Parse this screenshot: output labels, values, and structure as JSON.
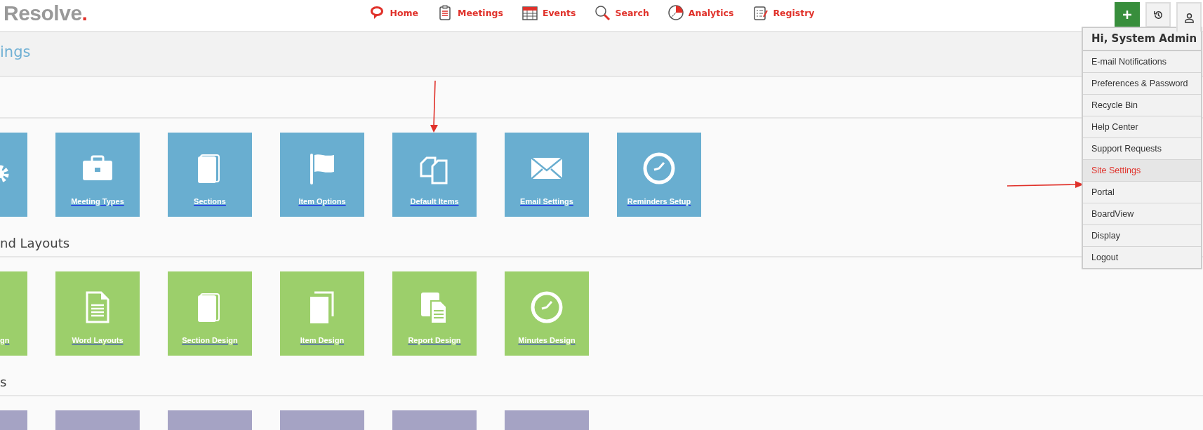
{
  "logo": {
    "text": "Resolve",
    "dot": "."
  },
  "nav": [
    {
      "label": "Home"
    },
    {
      "label": "Meetings"
    },
    {
      "label": "Events"
    },
    {
      "label": "Search"
    },
    {
      "label": "Analytics"
    },
    {
      "label": "Registry"
    }
  ],
  "page_title": "ings",
  "sections": [
    {
      "color": "#69aed0",
      "tiles": [
        {
          "cut_off": true
        },
        {
          "label": "Meeting Types",
          "cut_off": false
        },
        {
          "label": "Sections",
          "cut_off": false
        },
        {
          "label": "Item Options",
          "cut_off": false
        },
        {
          "label": "Default Items",
          "cut_off": false
        },
        {
          "label": "Email Settings",
          "cut_off": false
        },
        {
          "label": "Reminders Setup",
          "cut_off": false
        }
      ]
    },
    {
      "heading": "nd Layouts",
      "color": "#9ccf6b",
      "tiles": [
        {
          "label": "gn",
          "cut_off": true
        },
        {
          "label": "Word Layouts",
          "cut_off": false
        },
        {
          "label": "Section Design",
          "cut_off": false
        },
        {
          "label": "Item Design",
          "cut_off": false
        },
        {
          "label": "Report Design",
          "cut_off": false
        },
        {
          "label": "Minutes Design",
          "cut_off": false
        }
      ]
    },
    {
      "heading": "s",
      "color": "#a5a3c4",
      "tiles": [
        {
          "cut_off": true
        },
        {
          "cut_off": false
        },
        {
          "cut_off": false
        },
        {
          "cut_off": false
        },
        {
          "cut_off": false
        },
        {
          "cut_off": false
        }
      ]
    }
  ],
  "account_menu": {
    "open": true,
    "greeting": "Hi, System Admin",
    "items": [
      {
        "label": "E-mail Notifications",
        "selected": false
      },
      {
        "label": "Preferences & Password",
        "selected": false
      },
      {
        "label": "Recycle Bin",
        "selected": false
      },
      {
        "label": "Help Center",
        "selected": false
      },
      {
        "label": "Support Requests",
        "selected": false
      },
      {
        "label": "Site Settings",
        "selected": true
      },
      {
        "label": "Portal",
        "selected": false
      },
      {
        "label": "BoardView",
        "selected": false
      },
      {
        "label": "Display",
        "selected": false
      },
      {
        "label": "Logout",
        "selected": false
      }
    ]
  }
}
